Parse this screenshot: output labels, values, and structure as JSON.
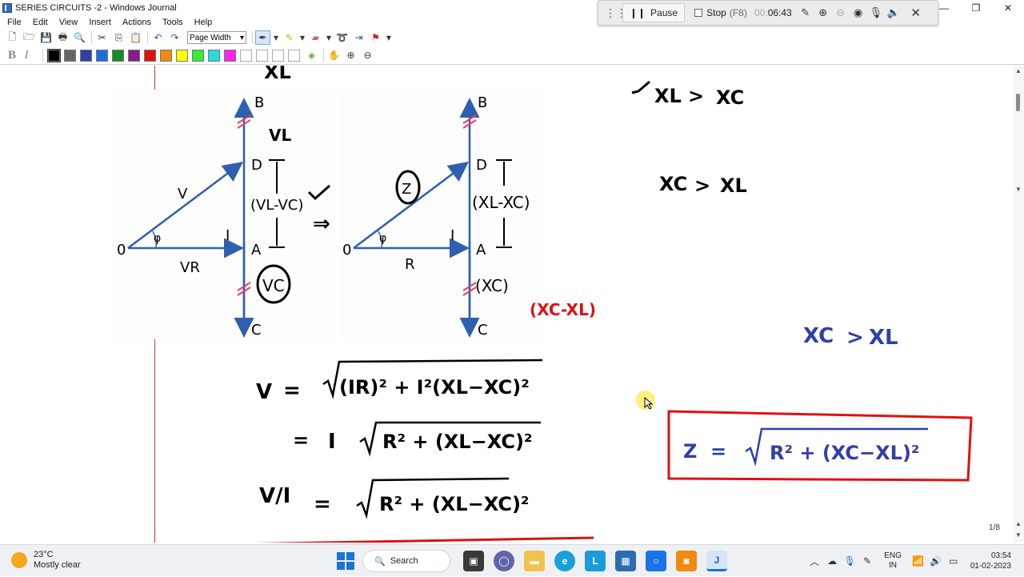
{
  "window": {
    "title": "SERIES CIRCUITS -2 - Windows Journal"
  },
  "menu": [
    "File",
    "Edit",
    "View",
    "Insert",
    "Actions",
    "Tools",
    "Help"
  ],
  "toolbar": {
    "zoom_value": "Page Width"
  },
  "palette": {
    "colors": [
      "#000000",
      "#666666",
      "#2f3fa8",
      "#1a6fe0",
      "#138c25",
      "#8b1a8b",
      "#e01010",
      "#f08a10",
      "#ffff00",
      "#33ee33",
      "#22dddd",
      "#ff22ee"
    ]
  },
  "recorder": {
    "pause_label": "Pause",
    "stop_label": "Stop",
    "stop_shortcut": "(F8)",
    "time_prefix": "00:",
    "time_value": "06:43"
  },
  "page": {
    "indicator": "1/8"
  },
  "notes": {
    "top_partial": "XL",
    "check1": "✓",
    "cond1_left": "XL",
    "cond1_right": "XC",
    "cond2_left": "XC",
    "cond2_right": "XL",
    "cond3_left": "XC",
    "cond3_right": "XL",
    "d1_VL": "VL",
    "d1_diff": "(VL-VC)",
    "d1_VC": "VC",
    "d1_V": "V",
    "d1_VR": "VR",
    "d1_I": "I",
    "d1_O": "0",
    "d1_phi": "φ",
    "d1_B": "B",
    "d1_D": "D",
    "d1_A": "A",
    "d1_C": "C",
    "arrow_implies": "⇒",
    "d2_Z": "Z",
    "d2_diff": "(XL-XC)",
    "d2_XC": "(XC)",
    "d2_R": "R",
    "d2_I": "I",
    "d2_O": "0",
    "d2_phi": "φ",
    "d2_B": "B",
    "d2_D": "D",
    "d2_A": "A",
    "d2_C": "C",
    "red_note": "(XC-XL)",
    "eq1_lhs": "V",
    "eq1_rhs": "(IR)² + I²(XL−XC)²",
    "eq2_factor": "I",
    "eq2_rhs": "R² + (XL−XC)²",
    "eq3_lhs": "V/I",
    "eq3_rhs": "R² + (XL−XC)²",
    "boxed_lhs": "Z",
    "boxed_rhs": "R² + (XC−XL)²"
  },
  "taskbar": {
    "weather_temp": "23°C",
    "weather_desc": "Mostly clear",
    "search_label": "Search",
    "lang_line1": "ENG",
    "lang_line2": "IN",
    "time": "03:54",
    "date": "01-02-2023"
  }
}
